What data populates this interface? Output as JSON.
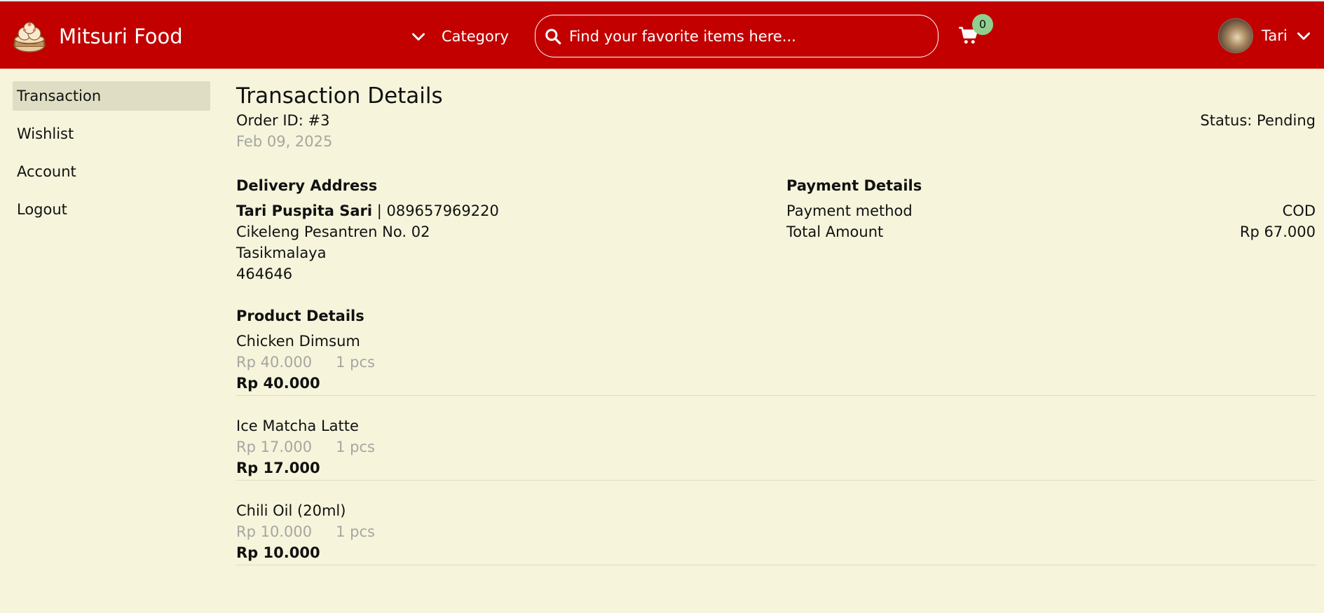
{
  "header": {
    "brand_name": "Mitsuri Food",
    "category_label": "Category",
    "search_placeholder": "Find your favorite items here...",
    "cart_count": "0",
    "user_name": "Tari"
  },
  "sidebar": {
    "items": [
      {
        "label": "Transaction"
      },
      {
        "label": "Wishlist"
      },
      {
        "label": "Account"
      },
      {
        "label": "Logout"
      }
    ]
  },
  "transaction": {
    "title": "Transaction Details",
    "order_id": "Order ID: #3",
    "status": "Status: Pending",
    "date": "Feb 09, 2025"
  },
  "delivery": {
    "heading": "Delivery Address",
    "name": "Tari Puspita Sari",
    "phone": " | 089657969220",
    "street": "Cikeleng Pesantren No. 02",
    "city": "Tasikmalaya",
    "postal": "464646"
  },
  "payment": {
    "heading": "Payment Details",
    "method_label": "Payment method",
    "method_value": "COD",
    "total_label": "Total Amount",
    "total_value": "Rp 67.000"
  },
  "products": {
    "heading": "Product Details",
    "items": [
      {
        "name": "Chicken Dimsum",
        "price": "Rp 40.000",
        "qty": "1 pcs",
        "subtotal": "Rp 40.000"
      },
      {
        "name": "Ice Matcha Latte",
        "price": "Rp 17.000",
        "qty": "1 pcs",
        "subtotal": "Rp 17.000"
      },
      {
        "name": "Chili Oil (20ml)",
        "price": "Rp 10.000",
        "qty": "1 pcs",
        "subtotal": "Rp 10.000"
      }
    ]
  },
  "colors": {
    "navbar": "#c20000",
    "background": "#f6f5dc",
    "sidebar_active": "#dfdec4",
    "cart_badge": "#8fd08f",
    "muted_text": "#a6a6a0"
  },
  "icons": {
    "logo": "dimsum-logo-icon",
    "category": "chevron-down-icon",
    "search": "search-icon",
    "cart": "cart-icon",
    "user_menu": "chevron-down-icon"
  }
}
